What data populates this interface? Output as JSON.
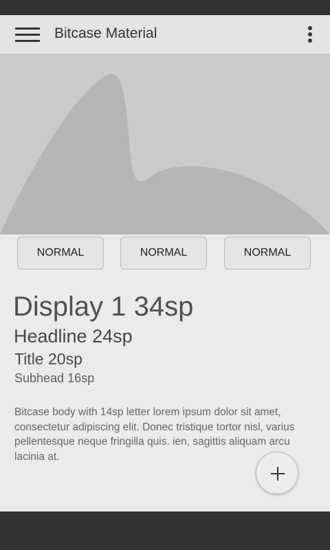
{
  "app_bar": {
    "title": "Bitcase Material",
    "menu_icon": "hamburger-menu-icon",
    "overflow_icon": "more-vert-icon"
  },
  "hero": {
    "image": "abstract-mountain-placeholder"
  },
  "buttons": [
    {
      "label": "NORMAL"
    },
    {
      "label": "NORMAL"
    },
    {
      "label": "NORMAL"
    }
  ],
  "typography": {
    "display1": "Display 1 34sp",
    "headline": "Headline 24sp",
    "title": "Title 20sp",
    "subhead": "Subhead 16sp",
    "body": "Bitcase body with 14sp letter lorem ipsum dolor sit amet, consectetur adipiscing elit. Donec tristique tortor nisl, varius pellentesque neque fringilla quis. ien, sagittis aliquam arcu lacinia at."
  },
  "fab": {
    "icon": "plus-icon"
  },
  "colors": {
    "background": "#ebebeb",
    "app_bar": "#e4e4e4",
    "hero_bg": "#cbcbcb",
    "hero_shape": "#b5b5b5",
    "system_bars": "#333333"
  }
}
